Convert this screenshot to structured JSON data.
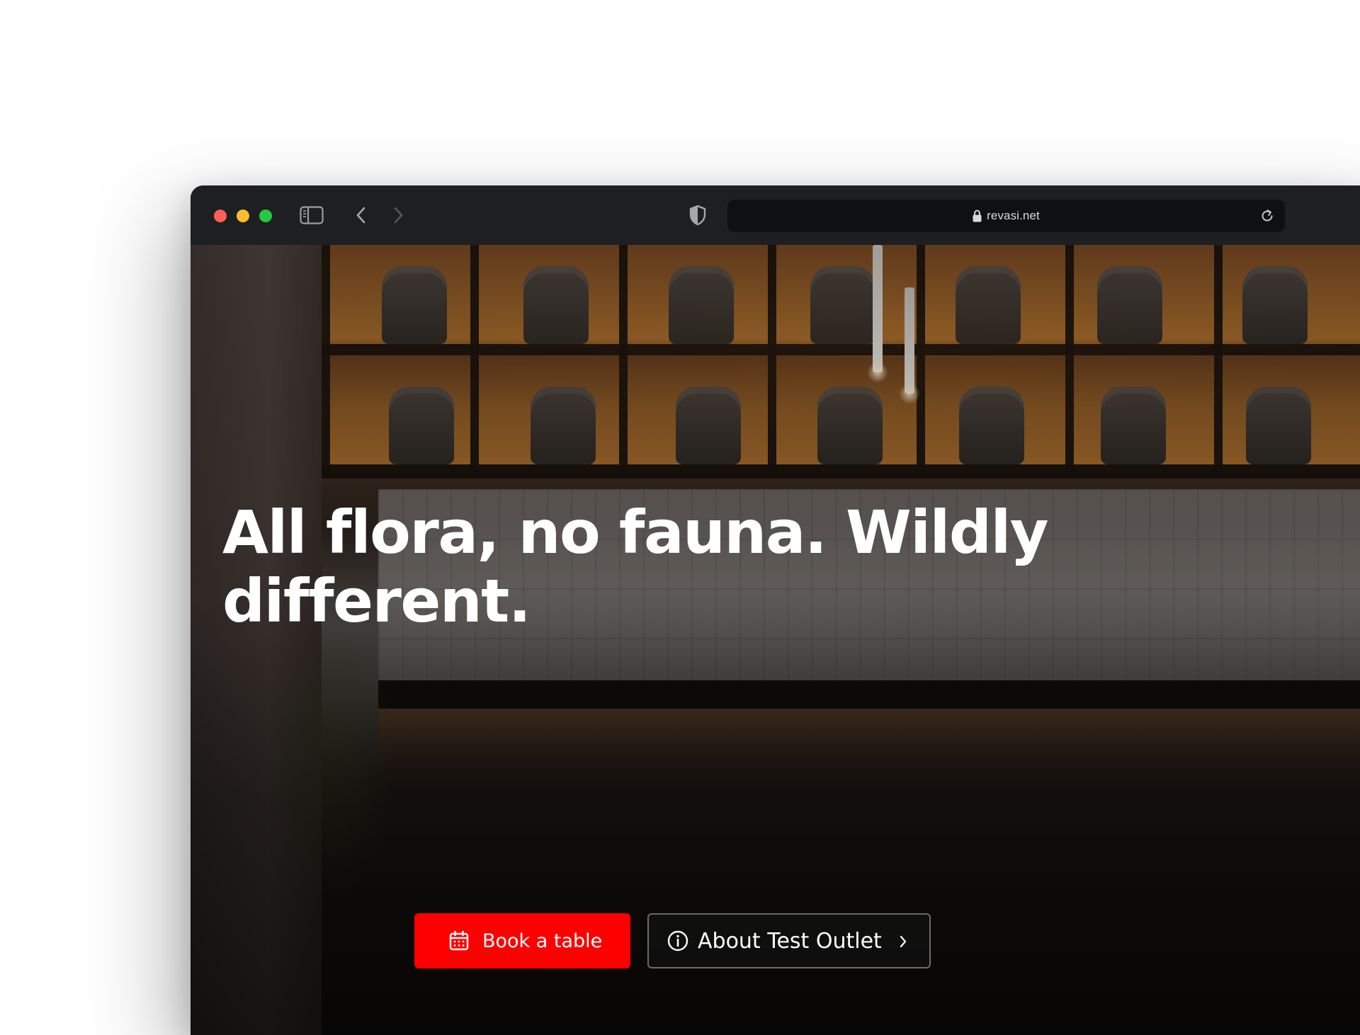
{
  "browser": {
    "url": "revasi.net",
    "icons": {
      "close": "close-traffic-light",
      "minimize": "minimize-traffic-light",
      "maximize": "maximize-traffic-light",
      "sidebar": "sidebar-icon",
      "back": "chevron-left-icon",
      "forward": "chevron-right-icon",
      "privacy": "shield-icon",
      "lock": "lock-icon",
      "reload": "reload-icon"
    },
    "colors": {
      "close": "#ff5f57",
      "minimize": "#febc2e",
      "maximize": "#28c840"
    }
  },
  "hero": {
    "heading": "All flora, no fauna. Wildly different.",
    "primary_button": {
      "label": "Book a table",
      "icon": "calendar-icon",
      "color": "#ff0000"
    },
    "secondary_button": {
      "label": "About Test Outlet",
      "icon": "info-icon",
      "trailing_icon": "chevron-right-icon"
    }
  }
}
